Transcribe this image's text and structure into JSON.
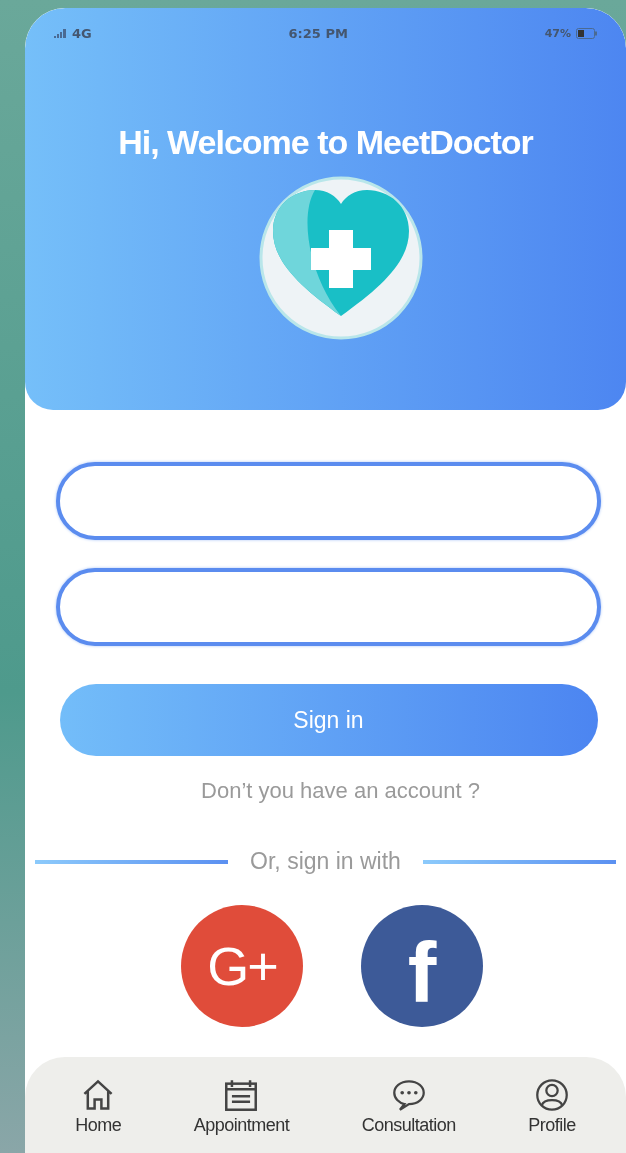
{
  "status_bar": {
    "network": "4G",
    "time": "6:25 PM",
    "battery": "47%"
  },
  "header": {
    "title": "Hi, Welcome to MeetDoctor"
  },
  "form": {
    "fields": [
      {
        "kind": "text"
      },
      {
        "kind": "text"
      }
    ],
    "submit": "Sign in",
    "signup_link": "Don’t you have an account ?"
  },
  "social": {
    "divider_label": "Or, sign in with",
    "buttons": [
      {
        "kind": "google",
        "label": "G+",
        "color": "#e04c3a"
      },
      {
        "kind": "facebook",
        "label": "f",
        "color": "#3d5a98"
      }
    ]
  },
  "bottom_nav": [
    {
      "kind": "home",
      "label": "Home"
    },
    {
      "kind": "calendar",
      "label": "Appointment"
    },
    {
      "kind": "chat",
      "label": "Consultation"
    },
    {
      "kind": "profile",
      "label": "Profile"
    }
  ]
}
